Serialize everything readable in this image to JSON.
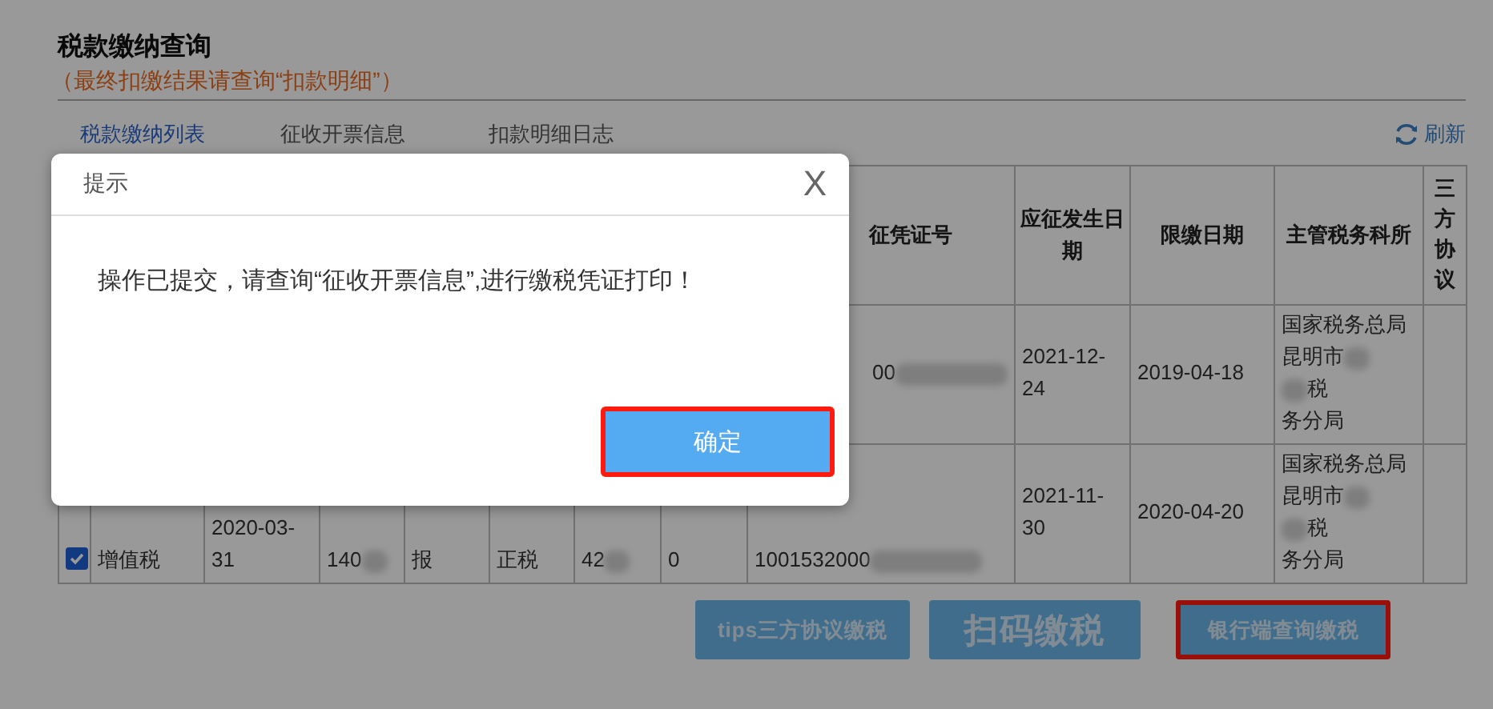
{
  "page": {
    "title": "税款缴纳查询",
    "note": "（最终扣缴结果请查询“扣款明细”）"
  },
  "tabs": [
    {
      "label": "税款缴纳列表",
      "selected": true
    },
    {
      "label": "征收开票信息",
      "selected": false
    },
    {
      "label": "扣款明细日志",
      "selected": false
    }
  ],
  "refresh": {
    "label": "刷新"
  },
  "table": {
    "headers": [
      "征凭证号",
      "应征发生日期",
      "限缴日期",
      "主管税务科所",
      "三方协议"
    ],
    "rows": [
      [
        "",
        "",
        "",
        "",
        "",
        "",
        "",
        "",
        {
          "lines": [
            [
              {
                "kind": "text",
                "text": "00"
              },
              {
                "kind": "redacted"
              }
            ]
          ]
        },
        "2021-12-24",
        "2019-04-18",
        {
          "lines": [
            [
              {
                "kind": "text",
                "text": "国家税务总局"
              }
            ],
            [
              {
                "kind": "text",
                "text": "昆明市"
              },
              {
                "kind": "redacted"
              }
            ],
            [
              {
                "kind": "redacted"
              },
              {
                "kind": "text",
                "text": "税"
              }
            ],
            [
              {
                "kind": "text",
                "text": "务分局"
              }
            ]
          ]
        },
        ""
      ],
      [
        {
          "kind": "checkbox",
          "checked": true
        },
        "增值税",
        "2020-03-31",
        {
          "lines": [
            [
              {
                "kind": "text",
                "text": "140"
              },
              {
                "kind": "redacted"
              }
            ]
          ]
        },
        "报",
        "正税",
        {
          "lines": [
            [
              {
                "kind": "text",
                "text": "42"
              },
              {
                "kind": "redacted"
              }
            ]
          ]
        },
        "0",
        {
          "lines": [
            [
              {
                "kind": "text",
                "text": "1001532000"
              },
              {
                "kind": "redacted"
              }
            ]
          ]
        },
        "2021-11-30",
        "2020-04-20",
        {
          "lines": [
            [
              {
                "kind": "text",
                "text": "国家税务总局"
              }
            ],
            [
              {
                "kind": "text",
                "text": "昆明市"
              },
              {
                "kind": "redacted"
              }
            ],
            [
              {
                "kind": "redacted"
              },
              {
                "kind": "text",
                "text": "税"
              }
            ],
            [
              {
                "kind": "text",
                "text": "务分局"
              }
            ]
          ]
        },
        ""
      ]
    ]
  },
  "actions": [
    {
      "label": "tips三方协议缴税",
      "prominent": false,
      "highlighted": false
    },
    {
      "label": "扫码缴税",
      "prominent": true,
      "highlighted": false
    },
    {
      "label": "银行端查询缴税",
      "prominent": false,
      "highlighted": true
    }
  ],
  "dialog": {
    "title": "提示",
    "close": "X",
    "message": "操作已提交，请查询“征收开票信息”,进行缴税凭证打印！",
    "confirm": {
      "label": "确定",
      "highlighted": true
    }
  }
}
